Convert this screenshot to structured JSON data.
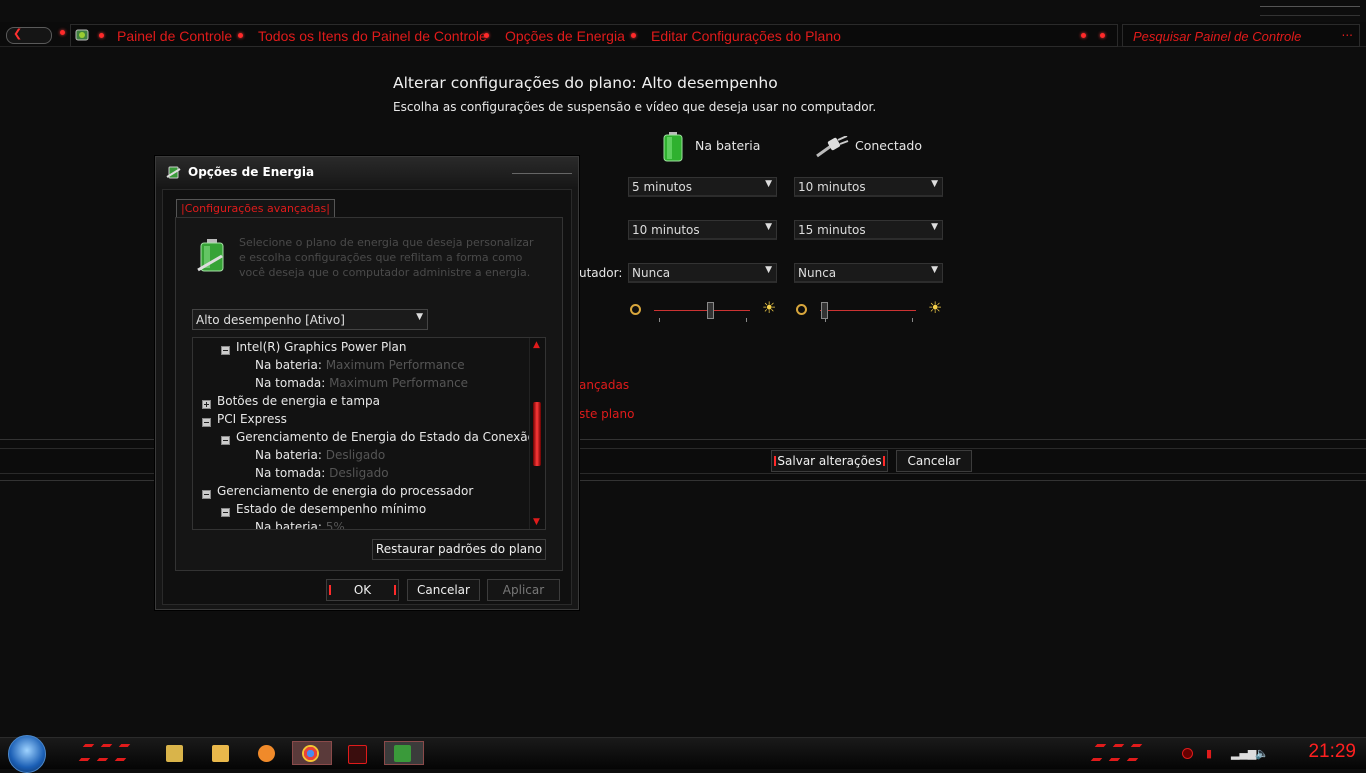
{
  "address_bar": {
    "back_icon": "back-arrow-icon",
    "breadcrumbs": [
      "Painel de Controle",
      "Todos os Itens do Painel de Controle",
      "Opções de Energia",
      "Editar Configurações do Plano"
    ],
    "search_placeholder": "Pesquisar Painel de Controle",
    "search_dots": "..."
  },
  "main": {
    "title": "Alterar configurações do plano: Alto desempenho",
    "subtitle": "Escolha as configurações de suspensão e vídeo que deseja usar no computador.",
    "col_battery": "Na bateria",
    "col_plugged": "Conectado",
    "row3_label_fragment": "utador:",
    "dropdowns": {
      "r1_battery": "5 minutos",
      "r1_plugged": "10 minutos",
      "r2_battery": "10 minutos",
      "r2_plugged": "15 minutos",
      "r3_battery": "Nunca",
      "r3_plugged": "Nunca"
    },
    "link_advanced_fragment": "ançadas",
    "link_restore_fragment": "ste plano",
    "save_button": "Salvar alterações",
    "cancel_button": "Cancelar"
  },
  "dialog": {
    "title": "Opções de Energia",
    "tab": "Configurações avançadas",
    "description": "Selecione o plano de energia que deseja personalizar e escolha configurações que reflitam a forma como você deseja que o computador administre a energia.",
    "plan_select": "Alto desempenho [Ativo]",
    "tree": {
      "intel": "Intel(R) Graphics Power Plan",
      "intel_bat_k": "Na bateria:",
      "intel_bat_v": "Maximum Performance",
      "intel_plug_k": "Na tomada:",
      "intel_plug_v": "Maximum Performance",
      "buttons": "Botões de energia e tampa",
      "pci": "PCI Express",
      "pci_link": "Gerenciamento de Energia do Estado da Conexão",
      "pci_bat_k": "Na bateria:",
      "pci_bat_v": "Desligado",
      "pci_plug_k": "Na tomada:",
      "pci_plug_v": "Desligado",
      "cpu": "Gerenciamento de energia do processador",
      "cpu_min": "Estado de desempenho mínimo",
      "cpu_bat_k": "Na bateria:",
      "cpu_bat_v": "5%"
    },
    "restore_button": "Restaurar padrões do plano",
    "ok_button": "OK",
    "cancel_button": "Cancelar",
    "apply_button": "Aplicar"
  },
  "taskbar": {
    "clock": "21:29"
  },
  "colors": {
    "accent_red": "#e01b1b",
    "background": "#0d0d0d"
  }
}
